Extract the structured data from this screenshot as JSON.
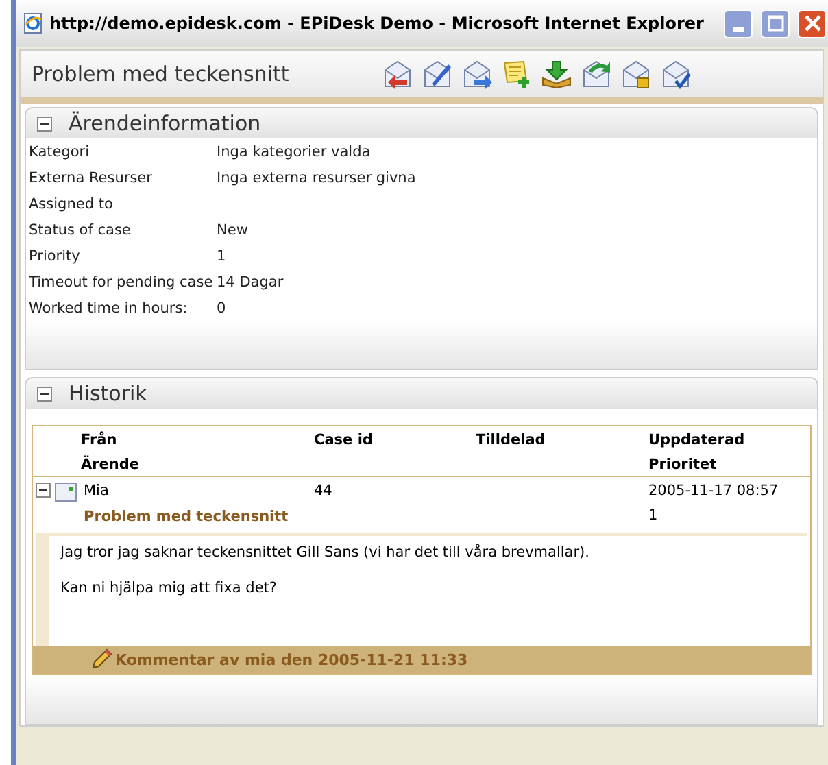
{
  "window": {
    "title": "http://demo.epidesk.com - EPiDesk Demo - Microsoft Internet Explorer"
  },
  "page_title": "Problem med teckensnitt",
  "info_panel": {
    "title": "Ärendeinformation",
    "expanded": true,
    "fields": [
      {
        "label": "Kategori",
        "value": "Inga kategorier valda"
      },
      {
        "label": "Externa Resurser",
        "value": "Inga externa resurser givna"
      },
      {
        "label": "Assigned to"
      },
      {
        "label": "Status of case",
        "value": "New"
      },
      {
        "label": "Priority",
        "value": "1"
      },
      {
        "label": "Timeout for pending case",
        "value": "14 Dagar"
      },
      {
        "label": "Worked time in hours:",
        "value": "0"
      }
    ]
  },
  "history_panel": {
    "title": "Historik",
    "expanded": true,
    "columns": [
      [
        "Från",
        "Ärende"
      ],
      [
        "Case id"
      ],
      [
        "Tilldelad"
      ],
      [
        "Uppdaterad",
        "Prioritet"
      ]
    ],
    "rows": [
      {
        "expanded": true,
        "from": "Mia",
        "case_id": "44",
        "updated": "2005-11-17 08:57",
        "subject": "Problem med teckensnitt",
        "priority": "1",
        "body": [
          "Jag tror jag saknar teckensnittet Gill Sans (vi har det till våra brevmallar).",
          "Kan ni hjälpa mig att fixa det?"
        ],
        "comment": "Kommentar av mia den 2005-11-21 11:33"
      }
    ]
  }
}
